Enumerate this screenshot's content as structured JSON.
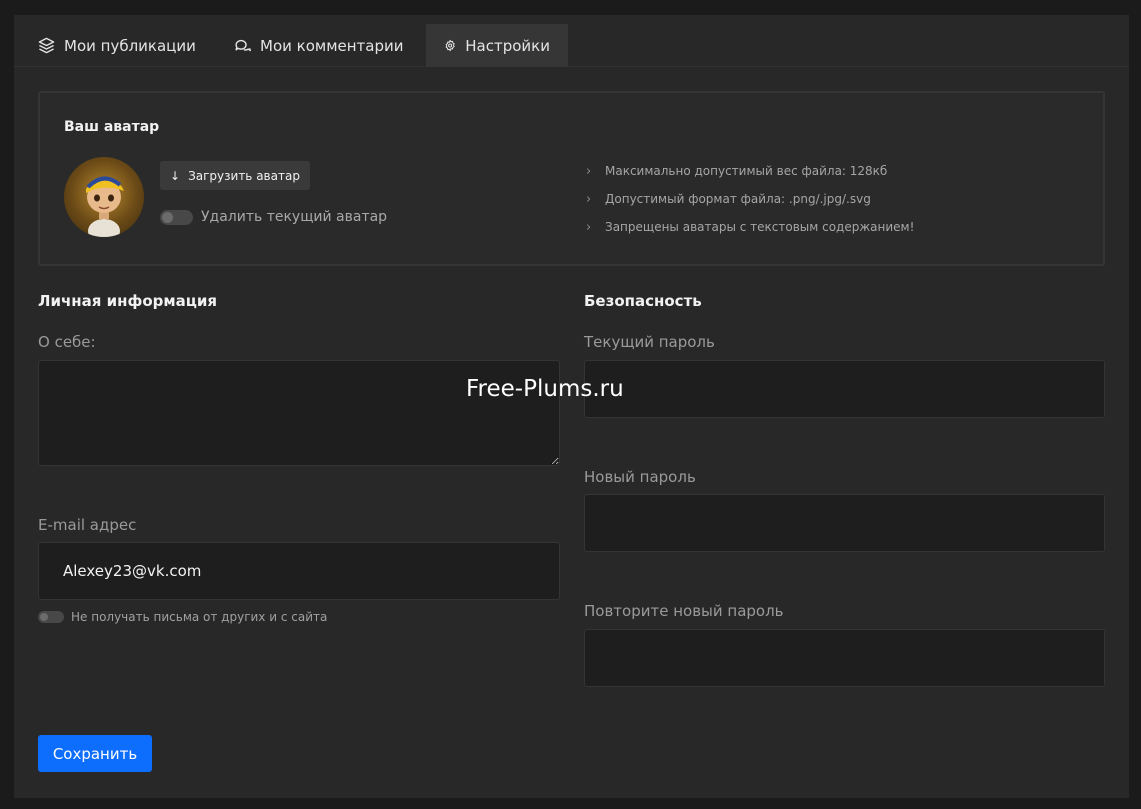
{
  "tabs": [
    {
      "label": "Мои публикации",
      "icon": "layers-icon"
    },
    {
      "label": "Мои комментарии",
      "icon": "chat-bubbles-icon"
    },
    {
      "label": "Настройки",
      "icon": "gear-icon",
      "active": true
    }
  ],
  "avatar": {
    "title": "Ваш аватар",
    "upload_label": "Загрузить аватар",
    "delete_label": "Удалить текущий аватар",
    "rules": [
      "Максимально допустимый вес файла: 128кб",
      "Допустимый формат файла: .png/.jpg/.svg",
      "Запрещены аватары с текстовым содержанием!"
    ]
  },
  "personal": {
    "title": "Личная информация",
    "about_label": "О себе:",
    "about_value": "",
    "email_label": "E-mail адрес",
    "email_value": "Alexey23@vk.com",
    "no_mail_label": "Не получать письма от других и с сайта"
  },
  "security": {
    "title": "Безопасность",
    "current_password_label": "Текущий пароль",
    "new_password_label": "Новый пароль",
    "repeat_password_label": "Повторите новый пароль"
  },
  "save_label": "Сохранить",
  "watermark": "Free-Plums.ru",
  "colors": {
    "background": "#1b1b1b",
    "panel": "#282828",
    "input": "#1e1e1e",
    "accent": "#0d6efd"
  }
}
